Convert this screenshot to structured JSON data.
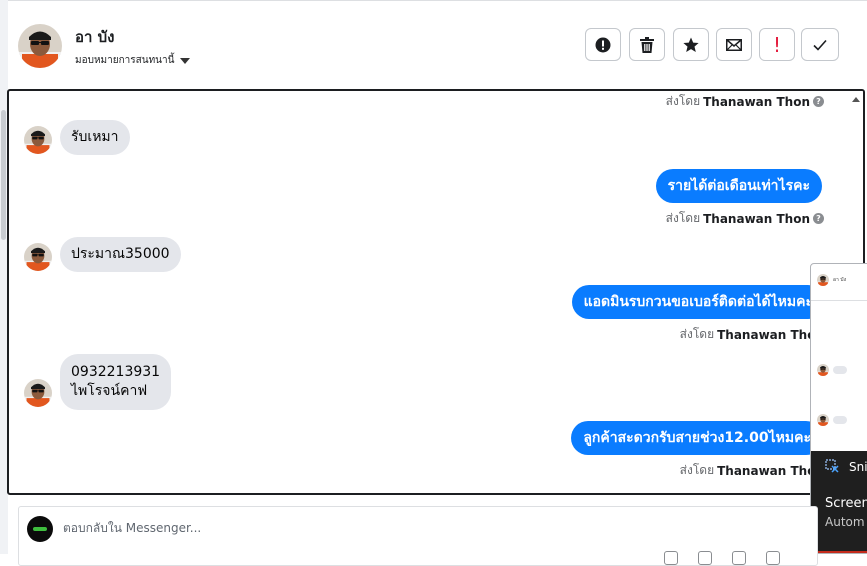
{
  "header": {
    "name": "อา บัง",
    "assign_label": "มอบหมายการสนทนานี้",
    "toolbar_excl": "!"
  },
  "messages": {
    "sent_by_prefix": "ส่งโดย",
    "agent": "Thanawan Thon",
    "help_mark": "?",
    "in_1": "รับเหมา",
    "out_1": "รายได้ต่อเดือนเท่าไรคะ",
    "in_2": "ประมาณ35000",
    "out_2": "แอดมินรบกวนขอเบอร์ติดต่อได้ไหมคะ",
    "in_3_line1": "0932213931",
    "in_3_line2": "ไพโรจน์คาฟ",
    "out_3": "ลูกค้าสะดวกรับสายช่วง12.00ไหมคะ"
  },
  "popup": {
    "mini_name": "อา บัง",
    "snip_name": "Sni",
    "snip_text1": "Screen",
    "snip_text2": "Autom"
  },
  "reply": {
    "placeholder": "ตอบกลับใน Messenger..."
  },
  "colors": {
    "outgoing_bubble": "#0a7cff",
    "incoming_bubble": "#e4e6eb",
    "danger": "#e41e3f"
  }
}
